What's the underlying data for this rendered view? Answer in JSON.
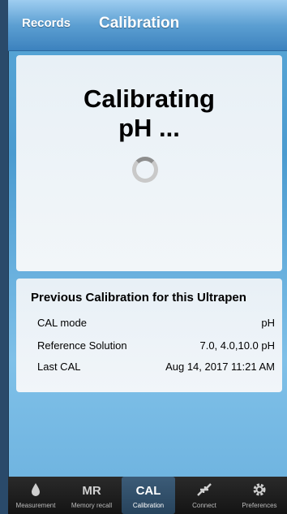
{
  "nav": {
    "back_label": "Records",
    "title": "Calibration"
  },
  "status": {
    "line1": "Calibrating",
    "line2": "pH ..."
  },
  "previous": {
    "title": "Previous Calibration for this Ultrapen",
    "rows": [
      {
        "label": "CAL mode",
        "value": "pH"
      },
      {
        "label": "Reference Solution",
        "value": "7.0, 4.0,10.0 pH"
      },
      {
        "label": "Last CAL",
        "value": "Aug 14, 2017  11:21 AM"
      }
    ]
  },
  "tabs": [
    {
      "label": "Measurement",
      "glyph": "",
      "icon": "drop-icon"
    },
    {
      "label": "Memory recall",
      "glyph": "MR",
      "icon": ""
    },
    {
      "label": "Calibration",
      "glyph": "CAL",
      "icon": "",
      "selected": true
    },
    {
      "label": "Connect",
      "glyph": "",
      "icon": "connect-arrows-icon"
    },
    {
      "label": "Preferences",
      "glyph": "",
      "icon": "gear-icon"
    }
  ]
}
